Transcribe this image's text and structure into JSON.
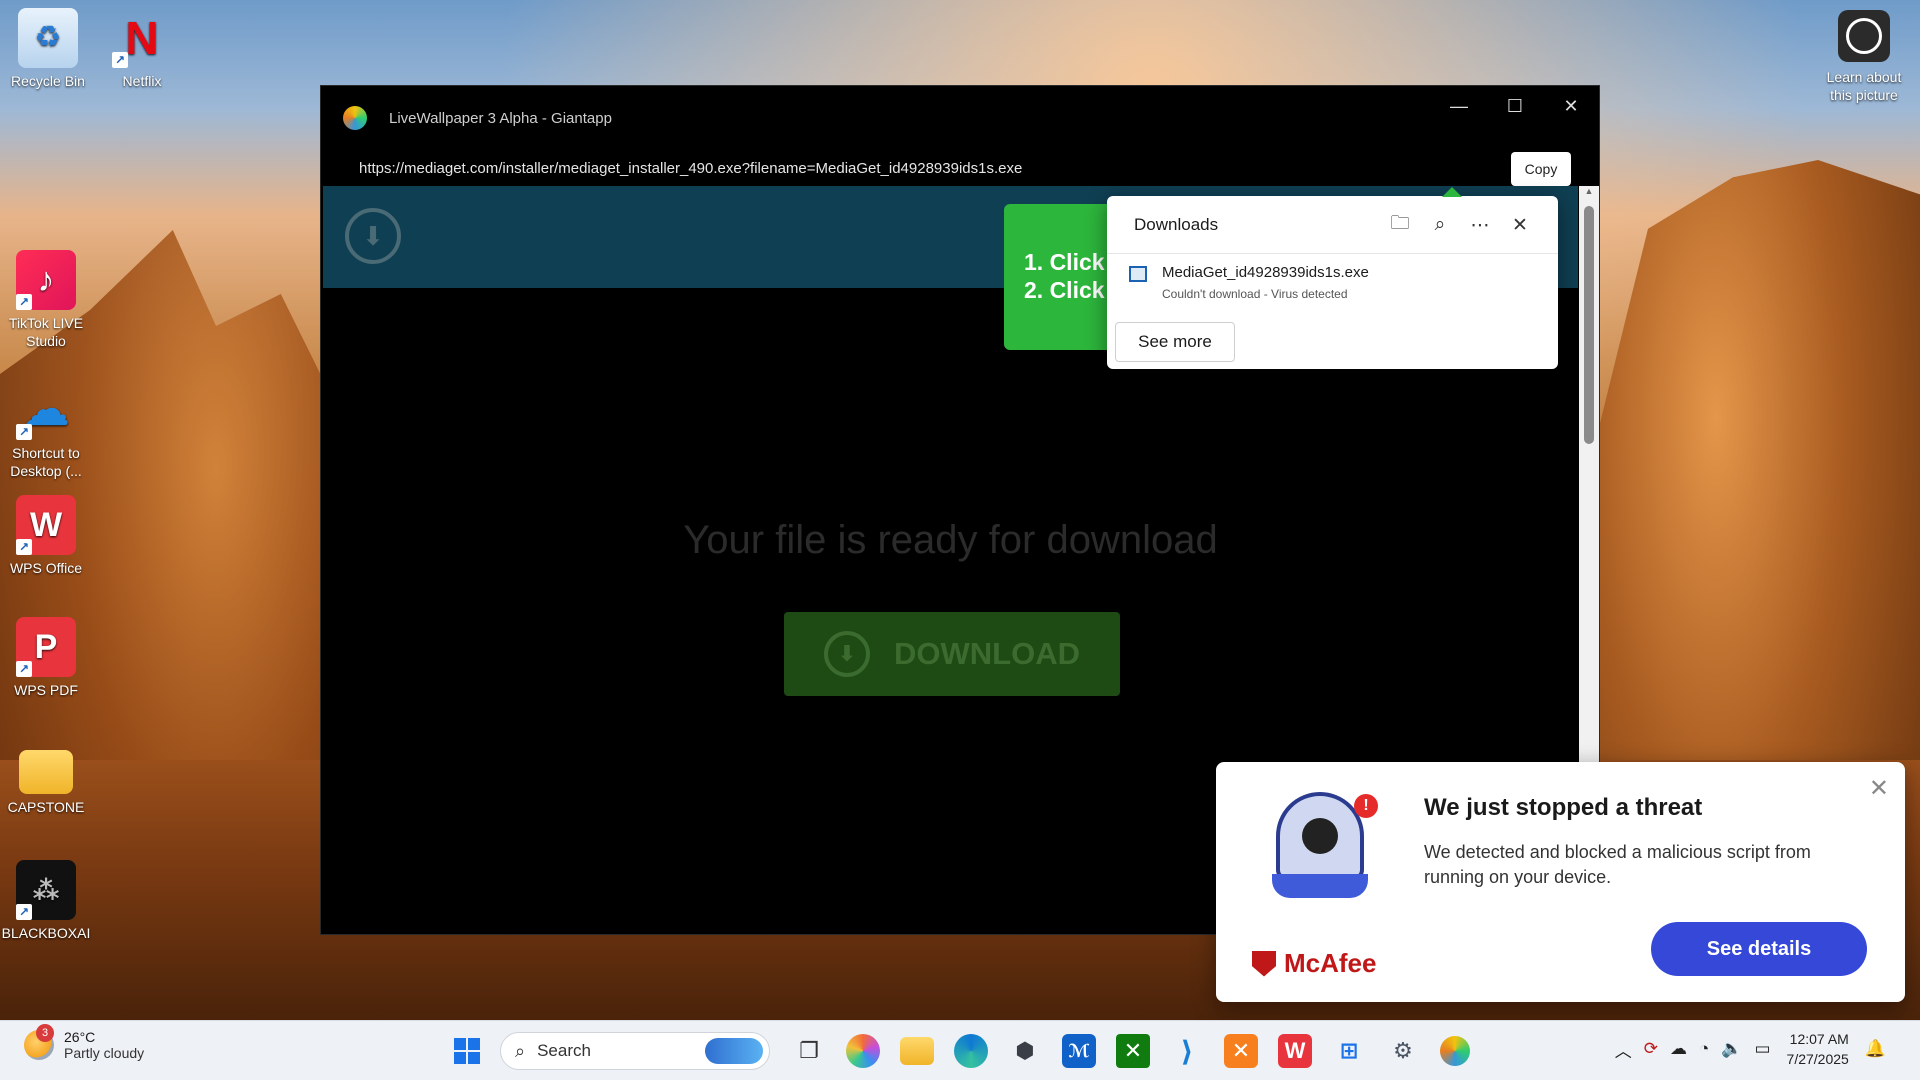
{
  "desktop": {
    "icons": [
      {
        "label": "Recycle Bin"
      },
      {
        "label": "Netflix"
      },
      {
        "label": "TikTok LIVE Studio"
      },
      {
        "label": "Shortcut to Desktop (..."
      },
      {
        "label": "WPS Office"
      },
      {
        "label": "WPS PDF"
      },
      {
        "label": "CAPSTONE"
      },
      {
        "label": "BLACKBOXAI"
      }
    ],
    "learn_label": "Learn about this picture"
  },
  "window": {
    "title": "LiveWallpaper 3 Alpha - Giantapp",
    "url": "https://mediaget.com/installer/mediaget_installer_490.exe?filename=MediaGet_id4928939ids1s.exe",
    "copy_label": "Copy",
    "banner_line1": "1. Click",
    "banner_line2": "2. Click",
    "ready_text": "Your file is ready for download",
    "download_label": "DOWNLOAD"
  },
  "downloads": {
    "title": "Downloads",
    "file_name": "MediaGet_id4928939ids1s.exe",
    "file_status": "Couldn't download - Virus detected",
    "see_more": "See more"
  },
  "mcafee": {
    "title": "We just stopped a threat",
    "body": "We detected and blocked a malicious script from running on your device.",
    "brand": "McAfee",
    "details_label": "See details",
    "alert": "!"
  },
  "taskbar": {
    "weather_badge": "3",
    "temperature": "26°C",
    "condition": "Partly cloudy",
    "search_placeholder": "Search",
    "time": "12:07 AM",
    "date": "7/27/2025"
  },
  "colors": {
    "accent": "#3548d8",
    "download_green": "#2db63c",
    "mcafee_red": "#c01818"
  }
}
